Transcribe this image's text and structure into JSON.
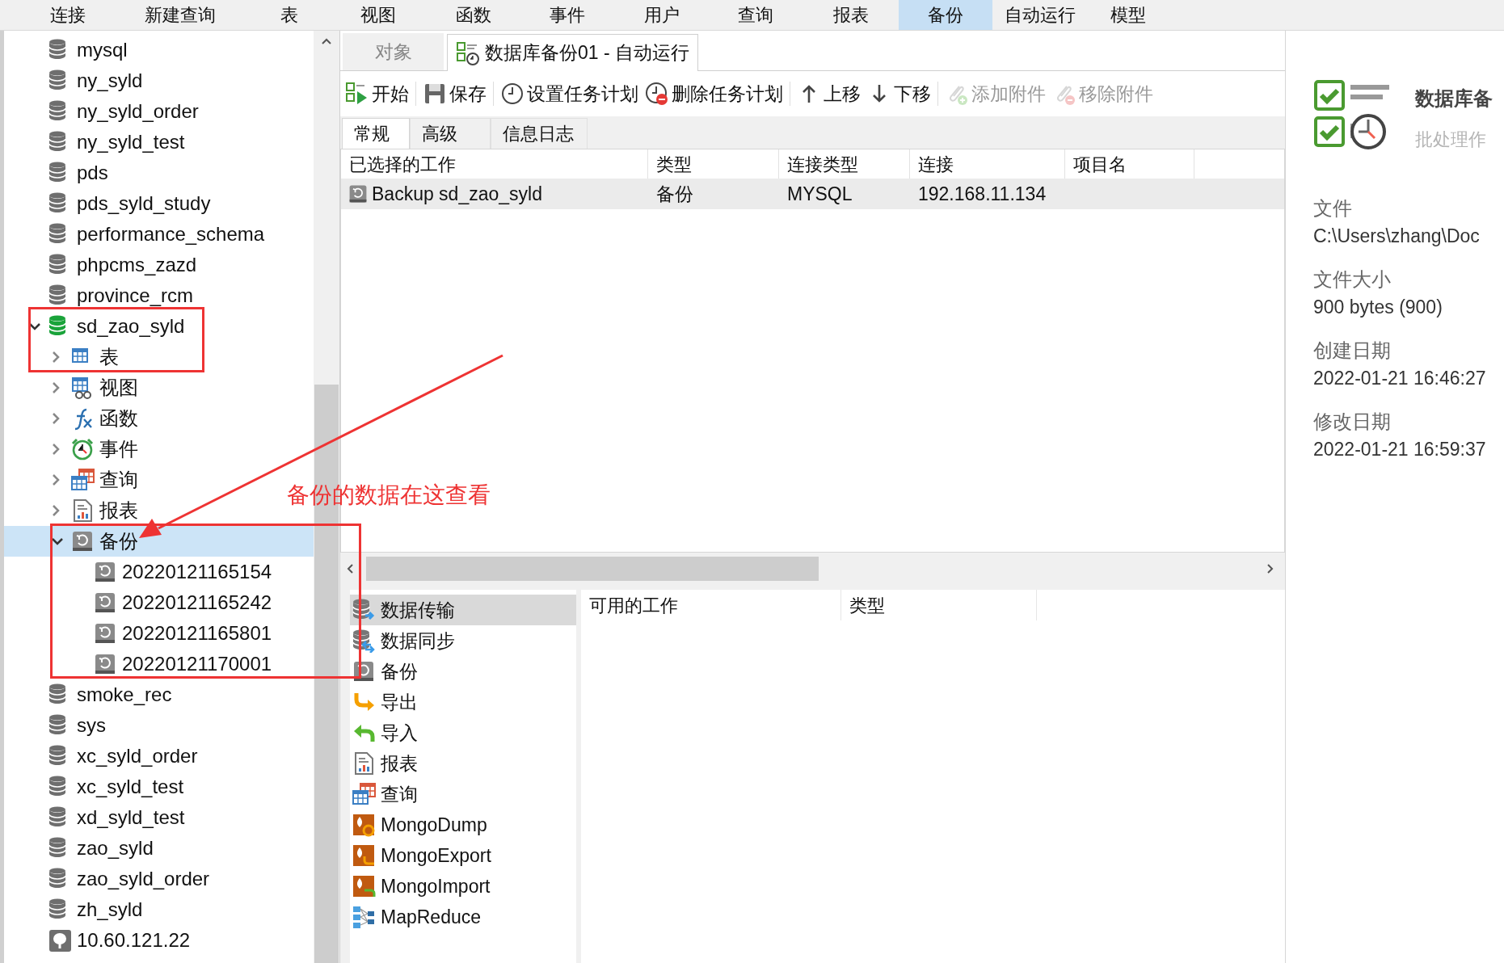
{
  "menu_bar": [
    {
      "label": "连接",
      "selected": false
    },
    {
      "label": "新建查询",
      "selected": false
    },
    {
      "label": "表",
      "selected": false
    },
    {
      "label": "视图",
      "selected": false
    },
    {
      "label": "函数",
      "selected": false
    },
    {
      "label": "事件",
      "selected": false
    },
    {
      "label": "用户",
      "selected": false
    },
    {
      "label": "查询",
      "selected": false
    },
    {
      "label": "报表",
      "selected": false
    },
    {
      "label": "备份",
      "selected": true
    },
    {
      "label": "自动运行",
      "selected": false
    },
    {
      "label": "模型",
      "selected": false
    }
  ],
  "object_tree": {
    "items": [
      {
        "label": "mysql",
        "kind": "database",
        "selected": false
      },
      {
        "label": "ny_syld",
        "kind": "database",
        "selected": false
      },
      {
        "label": "ny_syld_order",
        "kind": "database",
        "selected": false
      },
      {
        "label": "ny_syld_test",
        "kind": "database",
        "selected": false
      },
      {
        "label": "pds",
        "kind": "database",
        "selected": false
      },
      {
        "label": "pds_syld_study",
        "kind": "database",
        "selected": false
      },
      {
        "label": "performance_schema",
        "kind": "database",
        "selected": false
      },
      {
        "label": "phpcms_zazd",
        "kind": "database",
        "selected": false
      },
      {
        "label": "province_rcm",
        "kind": "database",
        "selected": false
      },
      {
        "label": "sd_zao_syld",
        "kind": "database-open",
        "selected": false,
        "expanded": true,
        "children": [
          {
            "label": "表",
            "kind": "table",
            "selected": false,
            "expanded": false
          },
          {
            "label": "视图",
            "kind": "view",
            "selected": false,
            "expanded": false
          },
          {
            "label": "函数",
            "kind": "function",
            "selected": false,
            "expanded": false
          },
          {
            "label": "事件",
            "kind": "event",
            "selected": false,
            "expanded": false
          },
          {
            "label": "查询",
            "kind": "query",
            "selected": false,
            "expanded": false
          },
          {
            "label": "报表",
            "kind": "report",
            "selected": false,
            "expanded": false
          },
          {
            "label": "备份",
            "kind": "backup",
            "selected": true,
            "expanded": true,
            "children": [
              {
                "label": "20220121165154",
                "kind": "backup",
                "selected": false
              },
              {
                "label": "20220121165242",
                "kind": "backup",
                "selected": false
              },
              {
                "label": "20220121165801",
                "kind": "backup",
                "selected": false
              },
              {
                "label": "20220121170001",
                "kind": "backup",
                "selected": false
              }
            ]
          }
        ]
      },
      {
        "label": "smoke_rec",
        "kind": "database",
        "selected": false
      },
      {
        "label": "sys",
        "kind": "database",
        "selected": false
      },
      {
        "label": "xc_syld_order",
        "kind": "database",
        "selected": false
      },
      {
        "label": "xc_syld_test",
        "kind": "database",
        "selected": false
      },
      {
        "label": "xd_syld_test",
        "kind": "database",
        "selected": false
      },
      {
        "label": "zao_syld",
        "kind": "database",
        "selected": false
      },
      {
        "label": "zao_syld_order",
        "kind": "database",
        "selected": false
      },
      {
        "label": "zh_syld",
        "kind": "database",
        "selected": false
      },
      {
        "label": "10.60.121.22",
        "kind": "server",
        "selected": false
      }
    ]
  },
  "tabs": [
    {
      "label": "对象",
      "selected": false
    },
    {
      "label": "数据库备份01 - 自动运行",
      "selected": true
    }
  ],
  "toolbar": [
    {
      "label": "开始",
      "kind": "start",
      "disabled": false
    },
    {
      "label": "保存",
      "kind": "save",
      "disabled": false
    },
    {
      "label": "设置任务计划",
      "kind": "schedule",
      "disabled": false
    },
    {
      "label": "删除任务计划",
      "kind": "unschedule",
      "disabled": false
    },
    {
      "label": "上移",
      "kind": "up",
      "disabled": false
    },
    {
      "label": "下移",
      "kind": "down",
      "disabled": false
    },
    {
      "label": "添加附件",
      "kind": "attach",
      "disabled": true
    },
    {
      "label": "移除附件",
      "kind": "detach",
      "disabled": true
    }
  ],
  "subtabs": [
    {
      "label": "常规",
      "selected": true
    },
    {
      "label": "高级",
      "selected": false
    },
    {
      "label": "信息日志",
      "selected": false
    }
  ],
  "selected_jobs": {
    "columns": [
      "已选择的工作",
      "类型",
      "连接类型",
      "连接",
      "项目名"
    ],
    "rows": [
      {
        "cells": [
          "Backup sd_zao_syld",
          "备份",
          "MYSQL",
          "192.168.11.134"
        ],
        "selected": true
      }
    ]
  },
  "job_types": [
    {
      "label": "数据传输",
      "kind": "transfer",
      "selected": true
    },
    {
      "label": "数据同步",
      "kind": "sync",
      "selected": false
    },
    {
      "label": "备份",
      "kind": "backup",
      "selected": false
    },
    {
      "label": "导出",
      "kind": "export",
      "selected": false
    },
    {
      "label": "导入",
      "kind": "import",
      "selected": false
    },
    {
      "label": "报表",
      "kind": "report",
      "selected": false
    },
    {
      "label": "查询",
      "kind": "query",
      "selected": false
    },
    {
      "label": "MongoDump",
      "kind": "mongo-dump",
      "selected": false
    },
    {
      "label": "MongoExport",
      "kind": "mongo-export",
      "selected": false
    },
    {
      "label": "MongoImport",
      "kind": "mongo-import",
      "selected": false
    },
    {
      "label": "MapReduce",
      "kind": "mapreduce",
      "selected": false
    }
  ],
  "available_jobs": {
    "columns": [
      "可用的工作",
      "类型"
    ]
  },
  "info_panel": {
    "title": "数据库备",
    "subtitle": "批处理作",
    "fields": [
      {
        "label": "文件",
        "value": "C:\\Users\\zhang\\Doc"
      },
      {
        "label": "文件大小",
        "value": "900 bytes (900)"
      },
      {
        "label": "创建日期",
        "value": "2022-01-21 16:46:27"
      },
      {
        "label": "修改日期",
        "value": "2022-01-21 16:59:37"
      }
    ]
  },
  "annotation": {
    "note": "备份的数据在这查看"
  }
}
